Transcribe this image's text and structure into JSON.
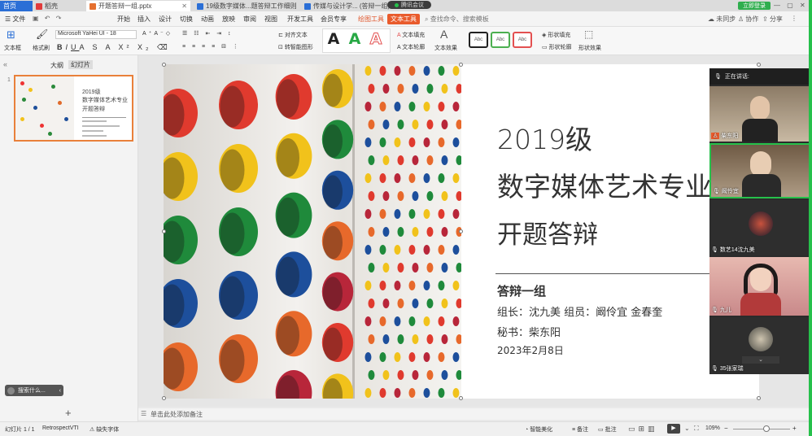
{
  "tabs": [
    {
      "label": "首页",
      "kind": "home"
    },
    {
      "label": "稻壳",
      "kind": "docer"
    },
    {
      "label": "开题答辩一组.pptx",
      "kind": "active"
    },
    {
      "label": "19级数字媒体...题答辩工作细则",
      "kind": "normal"
    },
    {
      "label": "传媒与设计学... (答辩一组)",
      "kind": "normal"
    }
  ],
  "meeting_pill": "腾讯会议",
  "login_button": "立即登录",
  "menu": {
    "file": "文件",
    "items": [
      "开始",
      "插入",
      "设计",
      "切换",
      "动画",
      "放映",
      "审阅",
      "视图",
      "开发工具",
      "会员专享"
    ],
    "drawing_tools": "绘图工具",
    "text_tools": "文本工具",
    "search_placeholder": "查找命令、搜索模板",
    "right": [
      "未同步",
      "协作",
      "分享"
    ]
  },
  "ribbon": {
    "textbox": "文本框",
    "format_painter": "格式刷",
    "font_name": "Microsoft YaHei UI",
    "font_size": "18",
    "align_text": "对齐文本",
    "smartart": "转智能图形",
    "text_fill": "文本填充",
    "text_outline": "文本轮廓",
    "text_effect": "文本效果",
    "shape_fill": "形状填充",
    "shape_outline": "形状轮廓",
    "shape_effect": "形状效果",
    "style_sample": "Abc"
  },
  "left_panel": {
    "tab_outline": "大纲",
    "tab_slides": "幻灯片",
    "slide_number": "1",
    "thumb_lines": [
      "2019级",
      "数字媒体艺术专业",
      "开题答辩"
    ],
    "search_chip": "搜索什么..."
  },
  "slide": {
    "title_line1": "2019级",
    "title_line2": "数字媒体艺术专业",
    "title_line3": "开题答辩",
    "group": "答辩一组",
    "leaders": "组长：沈九美  组员：阚伶宜  金春奎",
    "secretary": "秘书：柴东阳",
    "date": "2023年2月8日"
  },
  "notes_placeholder": "单击此处添加备注",
  "status": {
    "slide_info": "幻灯片 1 / 1",
    "theme": "RetrospectVTI",
    "missing_font": "缺失字体",
    "smart_beautify": "智能美化",
    "notes": "备注",
    "comments": "批注",
    "zoom": "109%"
  },
  "video": {
    "speaking": "正在讲话:",
    "participants": [
      {
        "name": "柴东阳"
      },
      {
        "name": "阚伶宜"
      },
      {
        "name": "数艺14沈九美"
      },
      {
        "name": "九儿"
      },
      {
        "name": "35张家瑞"
      }
    ]
  },
  "colors": {
    "accent_orange": "#e95b2c",
    "wps_blue": "#2b6fd6",
    "thumb_border": "#e9803a",
    "speaker_green": "#26c04b"
  }
}
